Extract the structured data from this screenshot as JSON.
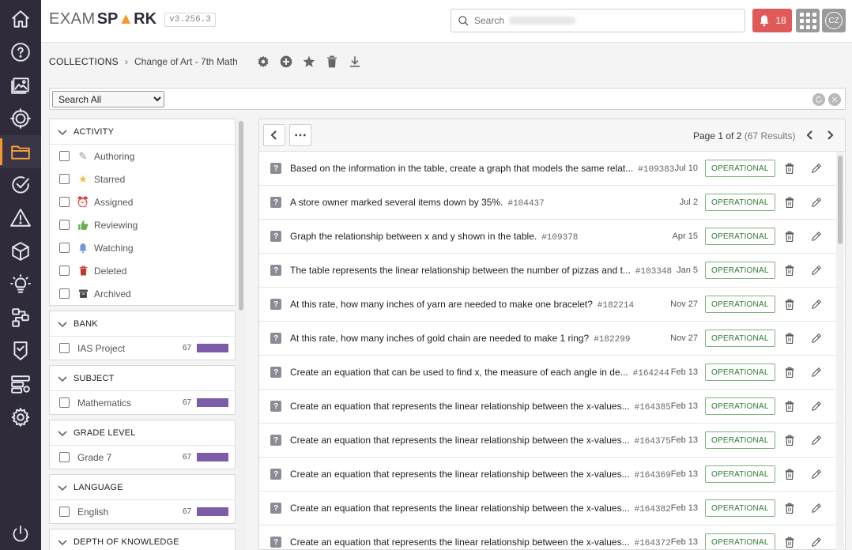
{
  "app": {
    "logo_exam": "EXAM",
    "logo_spark": "SP",
    "logo_spark_end": "RK",
    "version": "v3.256.3"
  },
  "header": {
    "search_placeholder": "Search",
    "notifications_count": "18",
    "avatar_initials": "CZ"
  },
  "rail": [
    {
      "name": "home-icon"
    },
    {
      "name": "help-icon"
    },
    {
      "name": "media-icon"
    },
    {
      "name": "target-icon"
    },
    {
      "name": "collections-folder-icon",
      "active": true
    },
    {
      "name": "review-check-icon"
    },
    {
      "name": "warning-icon"
    },
    {
      "name": "package-cube-icon"
    },
    {
      "name": "lightbulb-icon"
    },
    {
      "name": "workflow-icon"
    },
    {
      "name": "badge-icon"
    },
    {
      "name": "server-settings-icon"
    },
    {
      "name": "settings-gear-icon"
    }
  ],
  "breadcrumb": {
    "root": "COLLECTIONS",
    "current": "Change of Art - 7th Math"
  },
  "searchbar": {
    "scope_selected": "Search All",
    "scope_options": [
      "Search All"
    ]
  },
  "filters": {
    "activity": {
      "title": "ACTIVITY",
      "items": [
        {
          "label": "Authoring",
          "icon": "pencil-icon"
        },
        {
          "label": "Starred",
          "icon": "star-icon"
        },
        {
          "label": "Assigned",
          "icon": "alarm-clock-icon"
        },
        {
          "label": "Reviewing",
          "icon": "thumbs-up-icon"
        },
        {
          "label": "Watching",
          "icon": "bell-icon"
        },
        {
          "label": "Deleted",
          "icon": "trash-icon"
        },
        {
          "label": "Archived",
          "icon": "archive-box-icon"
        }
      ]
    },
    "bank": {
      "title": "BANK",
      "label": "IAS Project",
      "count": "67"
    },
    "subject": {
      "title": "SUBJECT",
      "label": "Mathematics",
      "count": "67"
    },
    "grade": {
      "title": "GRADE LEVEL",
      "label": "Grade 7",
      "count": "67"
    },
    "language": {
      "title": "LANGUAGE",
      "label": "English",
      "count": "67"
    },
    "dok": {
      "title": "DEPTH OF KNOWLEDGE"
    }
  },
  "results": {
    "page_prefix": "Page ",
    "page_current": "1",
    "page_of": " of ",
    "page_total": "2",
    "results_text": "(67 Results)",
    "status_color": "#2e7d32",
    "rows": [
      {
        "text": "Based on the information in the table, create a graph that models the same relat...",
        "id": "#109383",
        "date": "Jul 10",
        "status": "OPERATIONAL"
      },
      {
        "text": "A store owner marked several items down by 35%.",
        "id": "#104437",
        "date": "Jul 2",
        "status": "OPERATIONAL"
      },
      {
        "text": "Graph the relationship between x and y shown in the table.",
        "id": "#109378",
        "date": "Apr 15",
        "status": "OPERATIONAL"
      },
      {
        "text": "The table represents the linear relationship between the number of pizzas and t...",
        "id": "#103348",
        "date": "Jan 5",
        "status": "OPERATIONAL"
      },
      {
        "text": "At this rate, how many inches of yarn are needed to make one bracelet?",
        "id": "#182214",
        "date": "Nov 27",
        "status": "OPERATIONAL"
      },
      {
        "text": "At this rate, how many inches of gold chain are needed to make 1 ring?",
        "id": "#182299",
        "date": "Nov 27",
        "status": "OPERATIONAL"
      },
      {
        "text": "Create an equation that can be used to find x, the measure of each angle in de...",
        "id": "#164244",
        "date": "Feb 13",
        "status": "OPERATIONAL"
      },
      {
        "text": "Create an equation that represents the linear relationship between the x-values...",
        "id": "#164385",
        "date": "Feb 13",
        "status": "OPERATIONAL"
      },
      {
        "text": "Create an equation that represents the linear relationship between the x-values...",
        "id": "#164375",
        "date": "Feb 13",
        "status": "OPERATIONAL"
      },
      {
        "text": "Create an equation that represents the linear relationship between the x-values...",
        "id": "#164369",
        "date": "Feb 13",
        "status": "OPERATIONAL"
      },
      {
        "text": "Create an equation that represents the linear relationship between the x-values...",
        "id": "#164382",
        "date": "Feb 13",
        "status": "OPERATIONAL"
      },
      {
        "text": "Create an equation that represents the linear relationship between the x-values...",
        "id": "#164372",
        "date": "Feb 13",
        "status": "OPERATIONAL"
      }
    ]
  }
}
